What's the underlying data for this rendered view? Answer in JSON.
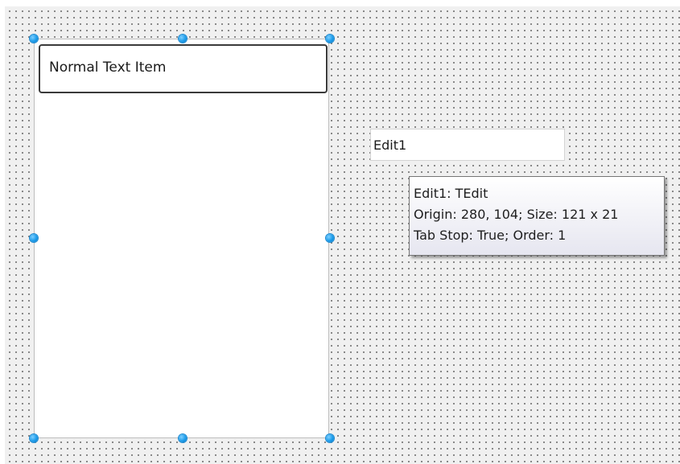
{
  "listbox": {
    "items": [
      "Normal Text Item"
    ]
  },
  "edit": {
    "value": "Edit1"
  },
  "tooltip": {
    "line1": "Edit1: TEdit",
    "line2": "Origin: 280, 104; Size: 121 x 21",
    "line3": "Tab Stop: True; Order: 1"
  },
  "colors": {
    "surface": "#f0f0f0",
    "grid_dot": "#6b6b6b",
    "selection_handle": "#1a9bea",
    "tooltip_border": "#767676"
  },
  "icons": {
    "selection_handle": "handle-dot-icon"
  }
}
